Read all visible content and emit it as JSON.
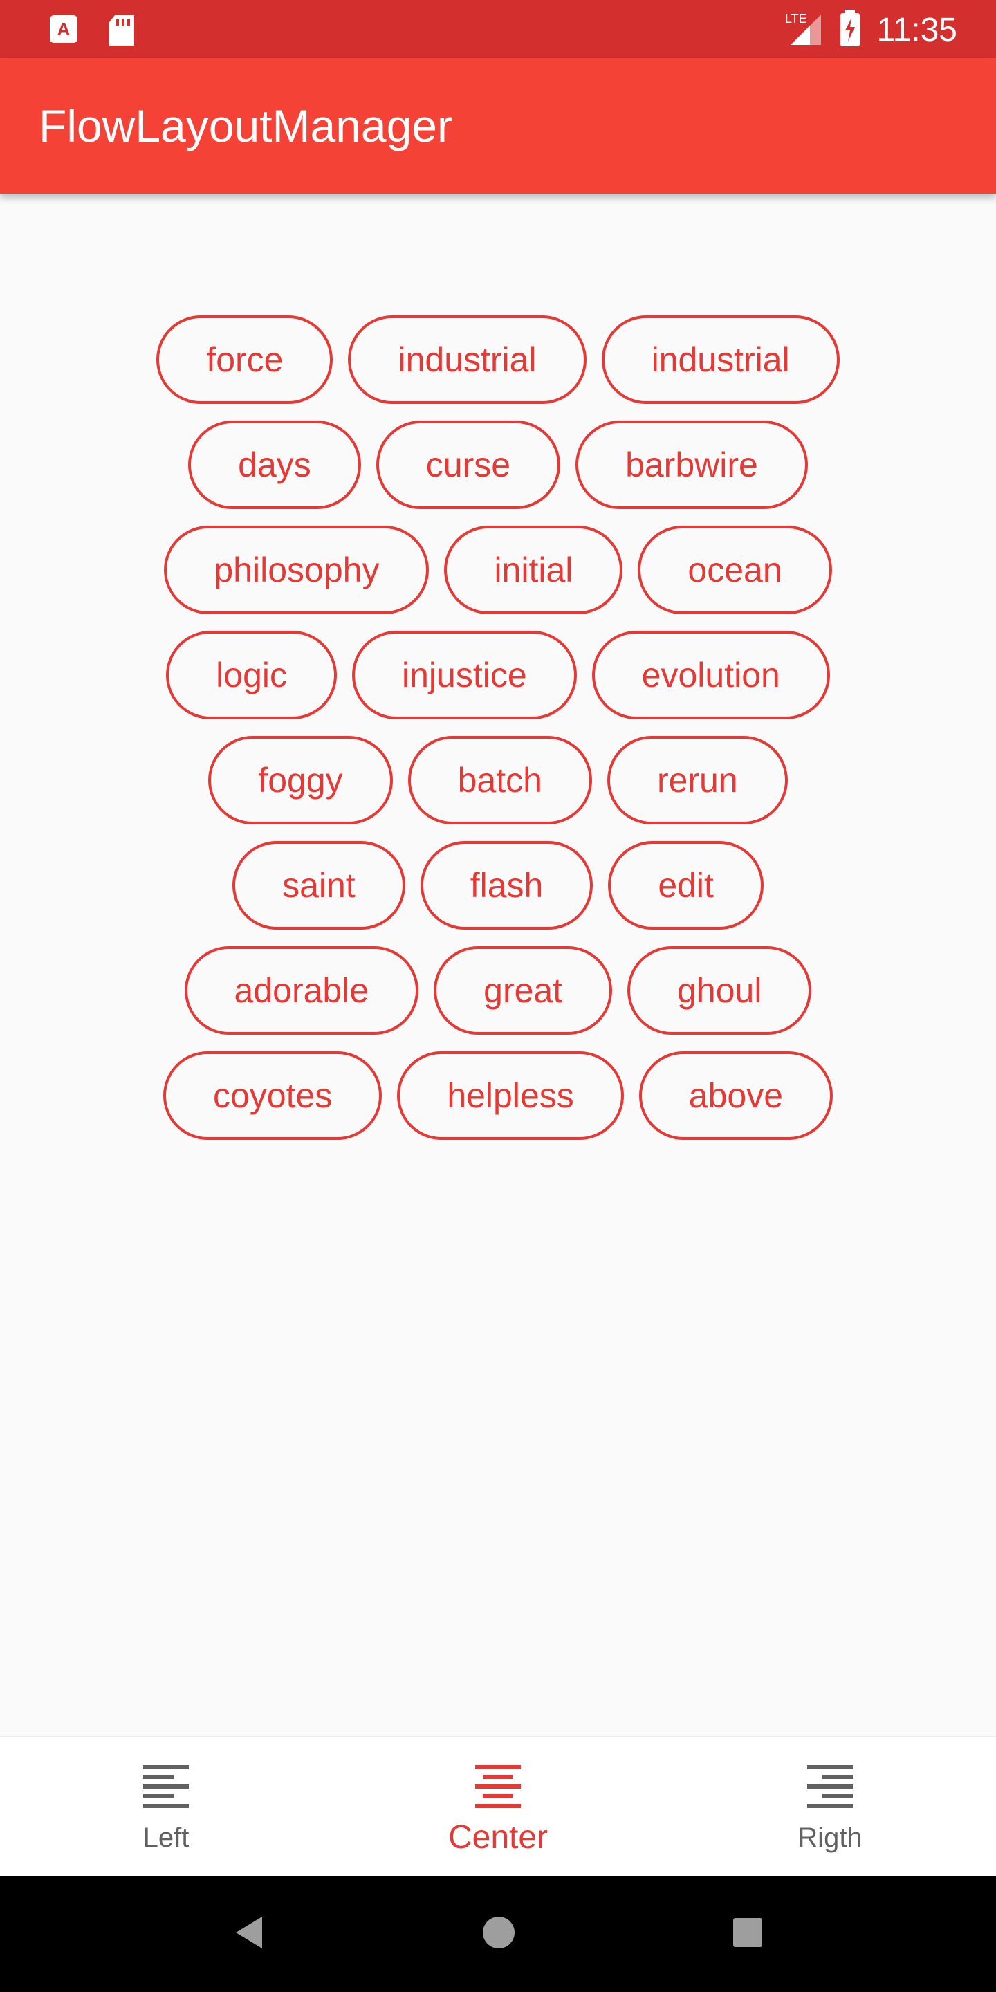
{
  "status_bar": {
    "time": "11:35",
    "network": "LTE",
    "icons": [
      "text-a-icon",
      "sd-card-icon",
      "signal-icon",
      "battery-charging-icon"
    ]
  },
  "app_bar": {
    "title": "FlowLayoutManager"
  },
  "chips": [
    "force",
    "industrial",
    "industrial",
    "days",
    "curse",
    "barbwire",
    "philosophy",
    "initial",
    "ocean",
    "logic",
    "injustice",
    "evolution",
    "foggy",
    "batch",
    "rerun",
    "saint",
    "flash",
    "edit",
    "adorable",
    "great",
    "ghoul",
    "coyotes",
    "helpless",
    "above"
  ],
  "bottom_nav": {
    "items": [
      {
        "label": "Left",
        "icon": "align-left-icon"
      },
      {
        "label": "Center",
        "icon": "align-center-icon"
      },
      {
        "label": "Rigth",
        "icon": "align-right-icon"
      }
    ],
    "active": "Center"
  },
  "colors": {
    "primary": "#f44336",
    "primary_dark": "#d32f2f",
    "accent": "#e53935",
    "background": "#fafafa"
  }
}
